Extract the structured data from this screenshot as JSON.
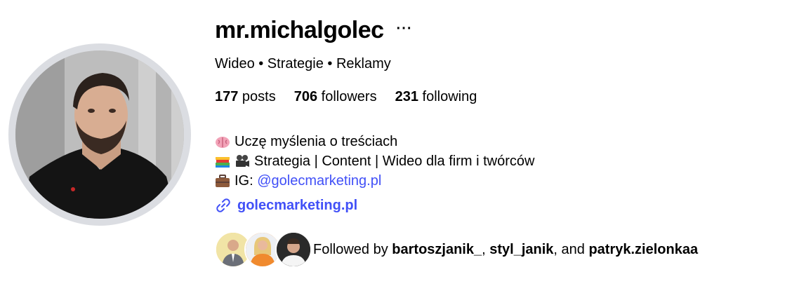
{
  "profile": {
    "username": "mr.michalgolec",
    "more_label": "···",
    "category": "Wideo • Strategie • Reklamy",
    "stats": {
      "posts_count": "177",
      "posts_label": " posts",
      "followers_count": "706",
      "followers_label": " followers",
      "following_count": "231",
      "following_label": " following"
    },
    "bio": {
      "line1_text": "Uczę myślenia o treściach",
      "line2_text": "Strategia | Content | Wideo dla firm i twórców",
      "line3_prefix": "IG: ",
      "line3_mention": "@golecmarketing.pl"
    },
    "link": "golecmarketing.pl",
    "followed_by": {
      "prefix": "Followed by ",
      "user1": "bartoszjanik_",
      "sep1": ", ",
      "user2": "styl_janik",
      "sep2": ", and ",
      "user3": "patryk.zielonkaa"
    }
  },
  "icons": {
    "bio_line1": "brain-icon",
    "bio_line2": "books-camera-icon",
    "bio_line3": "briefcase-icon",
    "link": "link-icon",
    "more": "more-horizontal-icon"
  },
  "colors": {
    "link_blue": "#4150f7",
    "avatar_ring": "#dbdde2",
    "text": "#000000"
  }
}
